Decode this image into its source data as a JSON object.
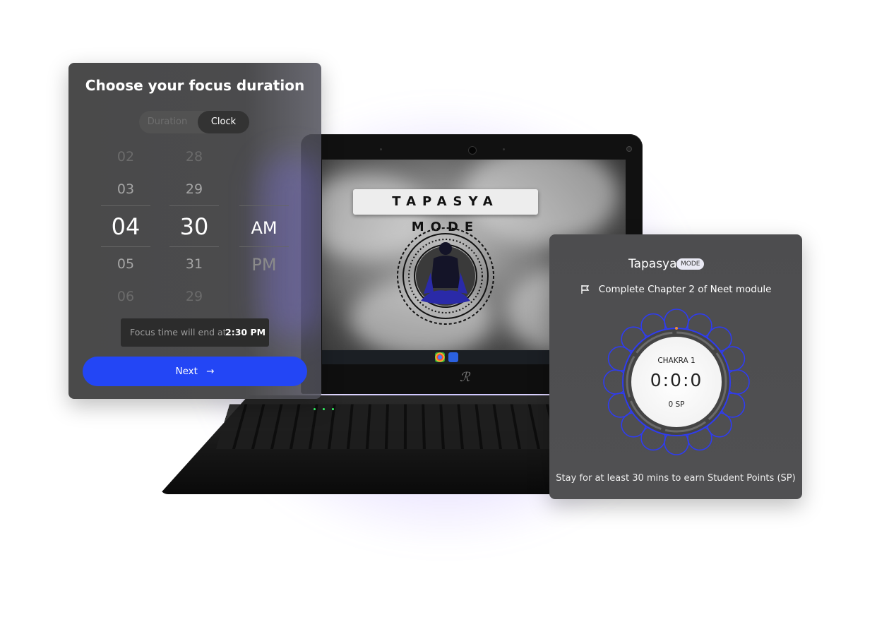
{
  "left_card": {
    "title": "Choose your focus duration",
    "tabs": [
      "Duration",
      "Clock"
    ],
    "active_tab": "Clock",
    "hours": [
      "02",
      "03",
      "04",
      "05",
      "06"
    ],
    "minutes": [
      "28",
      "29",
      "30",
      "31",
      "29"
    ],
    "selected_hour": "04",
    "selected_minute": "30",
    "meridiem": [
      "AM",
      "PM"
    ],
    "selected_meridiem": "AM",
    "end_label": "Focus time will end at",
    "end_time": "2:30 PM",
    "next_label": "Next",
    "next_icon": "arrow-right-icon"
  },
  "laptop": {
    "screen_banner": "TAPASYA MODE",
    "taskbar_icons": [
      "chrome-icon",
      "app-icon"
    ]
  },
  "right_card": {
    "brand": "Tapasya",
    "badge": "MODE",
    "task_icon": "flag-icon",
    "task": "Complete Chapter 2 of Neet module",
    "chakra_label": "CHAKRA 1",
    "timer": "0:0:0",
    "points": "0 SP",
    "footer": "Stay for at least 30 mins to earn Student Points (SP)",
    "ring_color": "#2f3cf0"
  },
  "colors": {
    "accent": "#2346f5",
    "card_bg": "#4a4a4a"
  }
}
